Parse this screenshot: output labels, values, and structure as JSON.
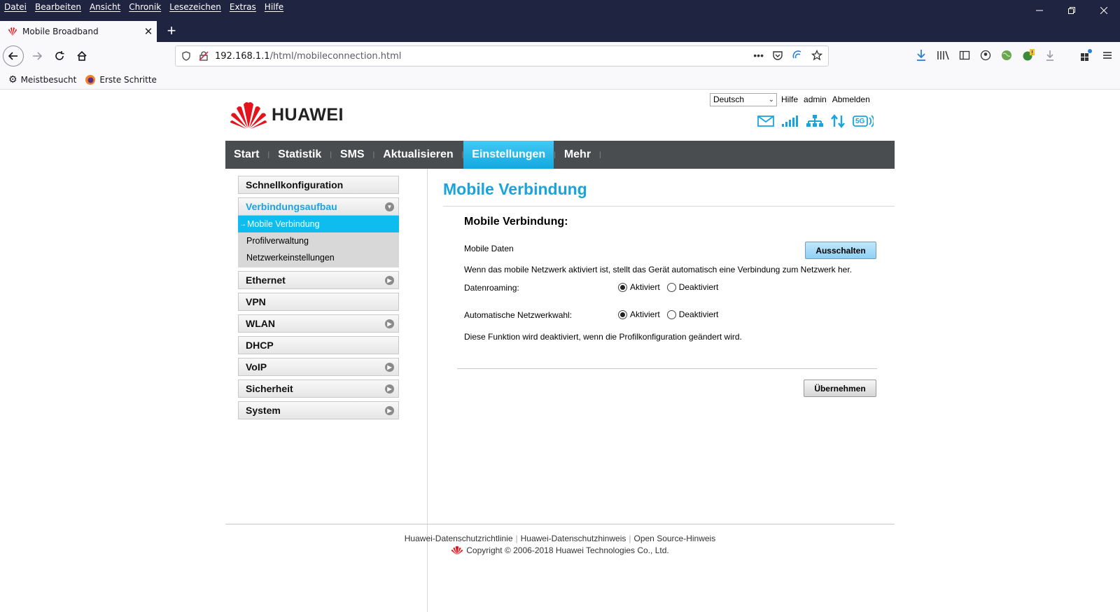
{
  "browser": {
    "menu": [
      "Datei",
      "Bearbeiten",
      "Ansicht",
      "Chronik",
      "Lesezeichen",
      "Extras",
      "Hilfe"
    ],
    "tab_title": "Mobile Broadband",
    "url_host": "192.168.1.1",
    "url_path": "/html/mobileconnection.html",
    "bookmarks": [
      "Meistbesucht",
      "Erste Schritte"
    ]
  },
  "header": {
    "language": "Deutsch",
    "links": [
      "Hilfe",
      "admin",
      "Abmelden"
    ],
    "brand": "HUAWEI",
    "network_badge": "5G"
  },
  "nav": [
    {
      "label": "Start",
      "active": false
    },
    {
      "label": "Statistik",
      "active": false
    },
    {
      "label": "SMS",
      "active": false
    },
    {
      "label": "Aktualisieren",
      "active": false
    },
    {
      "label": "Einstellungen",
      "active": true
    },
    {
      "label": "Mehr",
      "active": false
    }
  ],
  "sidebar": {
    "quick": "Schnellkonfiguration",
    "open_group": "Verbindungsaufbau",
    "sub": [
      "Mobile Verbindung",
      "Profilverwaltung",
      "Netzwerkeinstellungen"
    ],
    "active_arrow": "→",
    "groups": [
      "Ethernet",
      "VPN",
      "WLAN",
      "DHCP",
      "VoIP",
      "Sicherheit",
      "System"
    ]
  },
  "content": {
    "page_title": "Mobile Verbindung",
    "section_title": "Mobile Verbindung:",
    "mobile_data_label": "Mobile Daten",
    "mobile_data_button": "Ausschalten",
    "info_text": "Wenn das mobile Netzwerk aktiviert ist, stellt das Gerät automatisch eine Verbindung zum Netzwerk her.",
    "roaming_label": "Datenroaming:",
    "auto_label": "Automatische Netzwerkwahl:",
    "opt_on": "Aktiviert",
    "opt_off": "Deaktiviert",
    "roaming_value": "Aktiviert",
    "auto_value": "Aktiviert",
    "note": "Diese Funktion wird deaktiviert, wenn die Profilkonfiguration geändert wird.",
    "apply_button": "Übernehmen"
  },
  "footer": {
    "links": [
      "Huawei-Datenschutzrichtlinie",
      "Huawei-Datenschutzhinweis",
      "Open Source-Hinweis"
    ],
    "copyright": "Copyright © 2006-2018 Huawei Technologies Co., Ltd."
  },
  "colors": {
    "accent": "#1ba4dc",
    "nav_bg": "#4a4d50",
    "titlebar": "#1f2440"
  }
}
